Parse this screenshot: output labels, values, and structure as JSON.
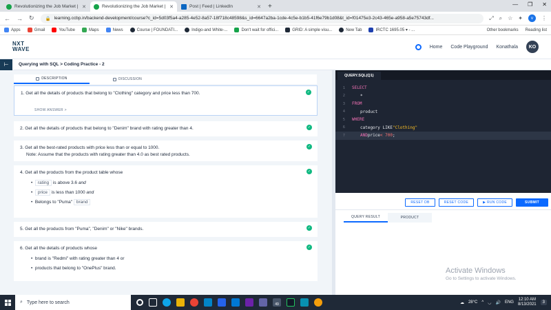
{
  "browser": {
    "tabs": [
      {
        "title": "Revolutionizing the Job Market |",
        "active": false,
        "color": "#16a34a"
      },
      {
        "title": "Revolutionizing the Job Market |",
        "active": true,
        "color": "#16a34a"
      },
      {
        "title": "Post | Feed | LinkedIn",
        "active": false,
        "color": "#0a66c2"
      }
    ],
    "url": "learning.ccbp.in/backend-development/course?c_id=5d03f5a4-a285-4e52-8a57-18f718c48598&s_id=6647a2ba-1cde-4c5e-b1b5-41f6e79b1d08&t_id=f01475e3-2c43-465e-a958-a5e75743df...",
    "profile_initial": "v",
    "bookmarks": [
      {
        "label": "Apps",
        "color": "#4285f4"
      },
      {
        "label": "Gmail",
        "color": "#ea4335"
      },
      {
        "label": "YouTube",
        "color": "#ff0000"
      },
      {
        "label": "Maps",
        "color": "#34a853"
      },
      {
        "label": "News",
        "color": "#4285f4"
      },
      {
        "label": "Course | FOUNDATI...",
        "color": "#1f2937"
      },
      {
        "label": "Indigo-and White-...",
        "color": "#1f2937"
      },
      {
        "label": "Don't wait for offici...",
        "color": "#16a34a"
      },
      {
        "label": "GRID: A simple visu...",
        "color": "#1f2937"
      },
      {
        "label": "New Tab",
        "color": "#1f2937"
      },
      {
        "label": "IRCTC 1695.05 ▾ - ...",
        "color": "#1e40af"
      }
    ],
    "other_bookmarks": "Other bookmarks",
    "reading_list": "Reading list"
  },
  "header": {
    "logo_line1": "NXT",
    "logo_line2": "WAVE",
    "nav_home": "Home",
    "nav_playground": "Code Playground",
    "user_name": "Konathala",
    "avatar_initials": "KO"
  },
  "breadcrumb": "Querying with SQL > Coding Practice - 2",
  "left": {
    "tab_description": "DESCRIPTION",
    "tab_discussion": "DISCUSSION",
    "show_answer": "SHOW ANSWER >",
    "q1": "1.  Get all the details of products that belong to \"Clothing\" category and price less than 700.",
    "q2": "2.  Get all the details of products that belong to \"Denim\" brand with rating greater than 4.",
    "q3a": "3.  Get all the best-rated products with price less than or equal to 1000.",
    "q3b": "Note: Assume that the products with rating greater than 4.0 as best rated products.",
    "q4": "4.  Get all the products from the product table whose",
    "q4_b1_code": "rating",
    "q4_b1_text": "is above 3.6",
    "q4_b1_and": "and",
    "q4_b2_code": "price",
    "q4_b2_text": "is less than 1000",
    "q4_b2_and": "and",
    "q4_b3_text": "Belongs to \"Puma\"",
    "q4_b3_code": "brand",
    "q5": "5.  Get all the products from \"Puma\", \"Denim\" or \"Nike\" brands.",
    "q6": "6.  Get all the details of products whose",
    "q6_b1": "brand is \"Redmi\" with rating greater than 4 or",
    "q6_b2": "products that belong to \"OnePlus\" brand."
  },
  "editor": {
    "tab": "QUERY.SQL(Q1)",
    "l1": "SELECT",
    "l2": "*",
    "l3": "FROM",
    "l4": "product",
    "l5": "WHERE",
    "l6_a": "category LIKE ",
    "l6_b": "\"Clothing\"",
    "l7_a": "AND",
    "l7_b": " price ",
    "l7_c": "< 700",
    "l7_d": ";",
    "btn_reset_db": "RESET DB",
    "btn_reset_code": "RESET CODE",
    "btn_run": "▶ RUN CODE",
    "btn_submit": "SUBMIT",
    "res_tab1": "QUERY RESULT",
    "res_tab2": "PRODUCT",
    "watermark1": "Activate Windows",
    "watermark2": "Go to Settings to activate Windows."
  },
  "taskbar": {
    "search": "Type here to search",
    "badge": "49",
    "temp": "28°C",
    "lang": "ENG",
    "time": "12:10 AM",
    "date": "8/13/2021",
    "notif": "3"
  }
}
